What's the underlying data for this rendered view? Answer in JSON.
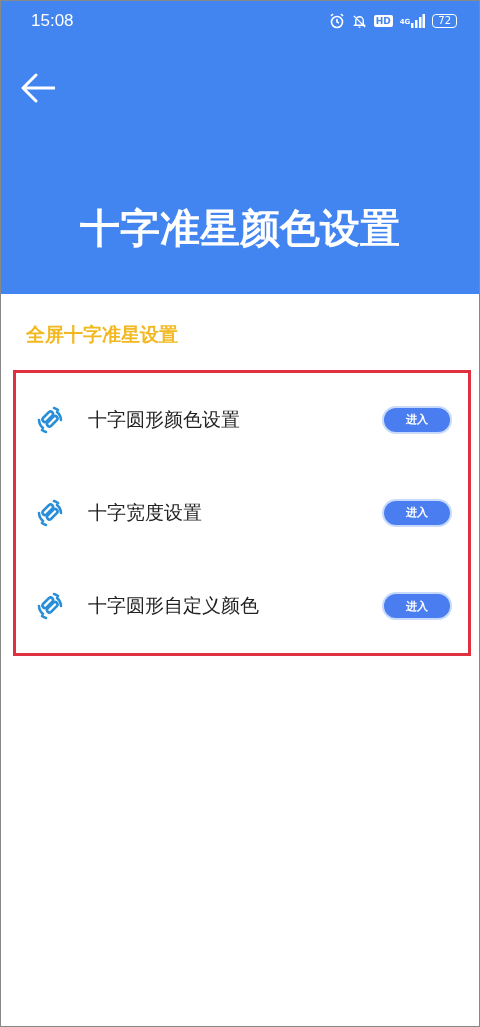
{
  "status_bar": {
    "time": "15:08",
    "hd": "HD",
    "network": "4G",
    "battery": "72"
  },
  "header": {
    "title": "十字准星颜色设置"
  },
  "section": {
    "title": "全屏十字准星设置"
  },
  "items": [
    {
      "label": "十字圆形颜色设置",
      "button": "进入"
    },
    {
      "label": "十字宽度设置",
      "button": "进入"
    },
    {
      "label": "十字圆形自定义颜色",
      "button": "进入"
    }
  ]
}
